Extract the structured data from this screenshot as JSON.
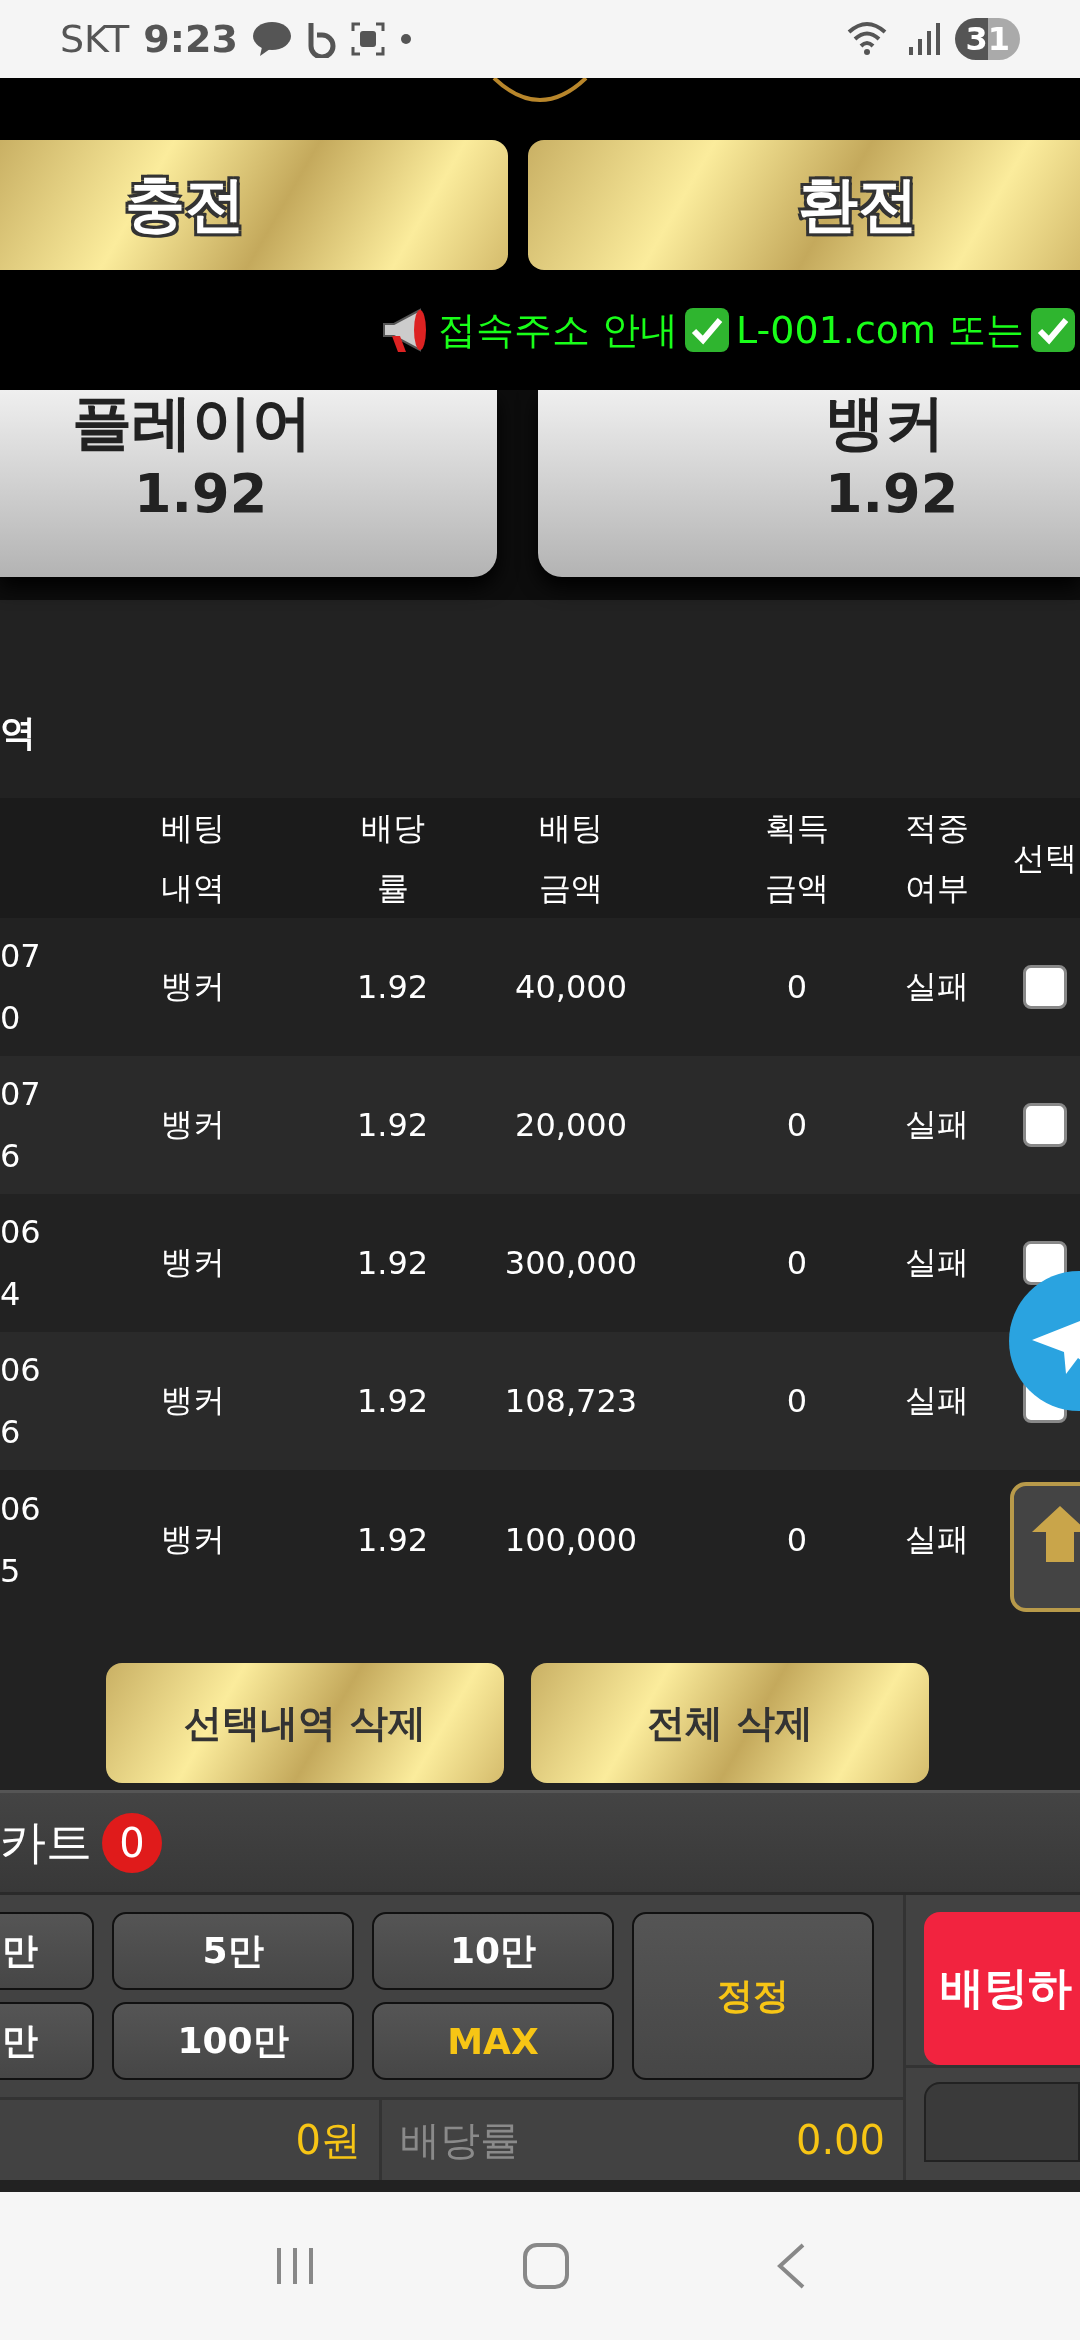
{
  "status_bar": {
    "carrier": "SKT",
    "time": "9:23",
    "battery": "31"
  },
  "header": {
    "buttons": [
      {
        "label": "충전"
      },
      {
        "label": "환전"
      }
    ]
  },
  "notice": [
    {
      "kind": "megaphone"
    },
    {
      "kind": "text",
      "text": "접속주소 안내"
    },
    {
      "kind": "check"
    },
    {
      "kind": "text",
      "text": "L-001.com 또는"
    },
    {
      "kind": "check"
    }
  ],
  "bet_options": [
    {
      "name": "플레이어",
      "odds": "1.92"
    },
    {
      "name": "뱅커",
      "odds": "1.92"
    }
  ],
  "history": {
    "title": "역",
    "columns": [
      [
        "베팅",
        "내역"
      ],
      [
        "배당",
        "률"
      ],
      [
        "배팅",
        "금액"
      ],
      [
        "획득",
        "금액"
      ],
      [
        "적중",
        "여부"
      ],
      [
        "선택"
      ]
    ],
    "rows": [
      {
        "column_1": [
          "07",
          "0"
        ],
        "bet": "뱅커",
        "odds": "1.92",
        "amount": "40,000",
        "win": "0",
        "result": "실패",
        "checked": false
      },
      {
        "column_1": [
          "07",
          "6"
        ],
        "bet": "뱅커",
        "odds": "1.92",
        "amount": "20,000",
        "win": "0",
        "result": "실패",
        "checked": false
      },
      {
        "column_1": [
          "06",
          "4"
        ],
        "bet": "뱅커",
        "odds": "1.92",
        "amount": "300,000",
        "win": "0",
        "result": "실패",
        "checked": false
      },
      {
        "column_1": [
          "06",
          "6"
        ],
        "bet": "뱅커",
        "odds": "1.92",
        "amount": "108,723",
        "win": "0",
        "result": "실패",
        "checked": false
      },
      {
        "column_1": [
          "06",
          "5"
        ],
        "bet": "뱅커",
        "odds": "1.92",
        "amount": "100,000",
        "win": "0",
        "result": "실패"
      }
    ],
    "buttons": [
      "선택내역 삭제",
      "전체 삭제"
    ]
  },
  "cart": {
    "title": "카트",
    "count": "0"
  },
  "chips": [
    {
      "label": "만",
      "kind": "amount"
    },
    {
      "label": "5만",
      "kind": "amount"
    },
    {
      "label": "10만",
      "kind": "amount"
    },
    {
      "label": "만",
      "kind": "amount"
    },
    {
      "label": "100만",
      "kind": "amount"
    },
    {
      "label": "MAX",
      "kind": "max"
    }
  ],
  "reset_button": "정정",
  "bet_button": "배팅하",
  "totals": {
    "amount": "0원",
    "odds_label": "배당률",
    "odds": "0.00"
  }
}
